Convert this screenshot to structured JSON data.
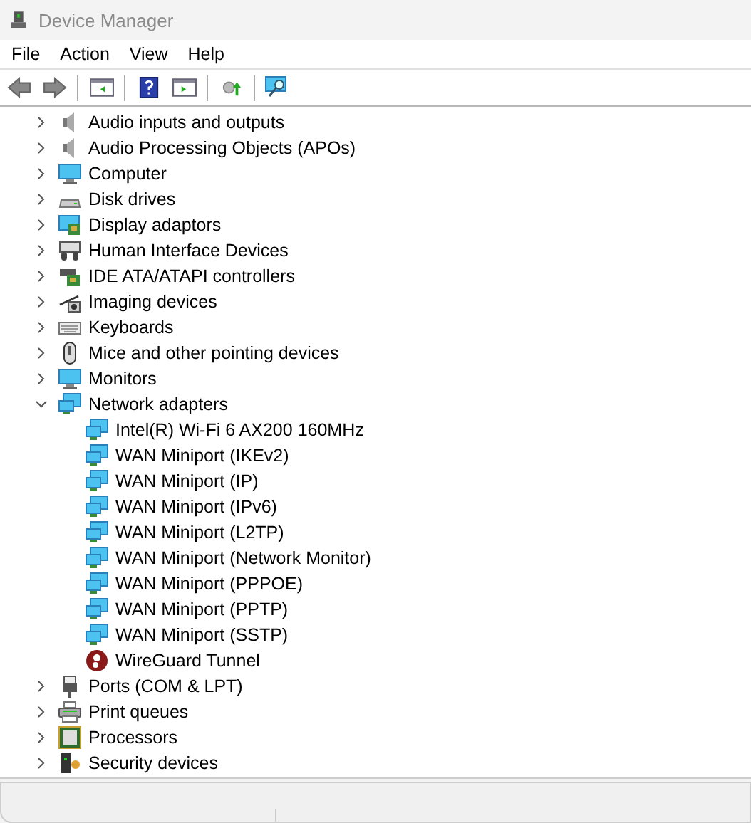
{
  "window": {
    "title": "Device Manager"
  },
  "menu": [
    "File",
    "Action",
    "View",
    "Help"
  ],
  "tree": [
    {
      "label": "Audio inputs and outputs",
      "expanded": false
    },
    {
      "label": "Audio Processing Objects (APOs)",
      "expanded": false
    },
    {
      "label": "Computer",
      "expanded": false
    },
    {
      "label": "Disk drives",
      "expanded": false
    },
    {
      "label": "Display adaptors",
      "expanded": false
    },
    {
      "label": "Human Interface Devices",
      "expanded": false
    },
    {
      "label": "IDE ATA/ATAPI controllers",
      "expanded": false
    },
    {
      "label": "Imaging devices",
      "expanded": false
    },
    {
      "label": "Keyboards",
      "expanded": false
    },
    {
      "label": "Mice and other pointing devices",
      "expanded": false
    },
    {
      "label": "Monitors",
      "expanded": false
    },
    {
      "label": "Network adapters",
      "expanded": true,
      "children": [
        {
          "label": "Intel(R) Wi-Fi 6 AX200 160MHz"
        },
        {
          "label": "WAN Miniport (IKEv2)"
        },
        {
          "label": "WAN Miniport (IP)"
        },
        {
          "label": "WAN Miniport (IPv6)"
        },
        {
          "label": "WAN Miniport (L2TP)"
        },
        {
          "label": "WAN Miniport (Network Monitor)"
        },
        {
          "label": "WAN Miniport (PPPOE)"
        },
        {
          "label": "WAN Miniport (PPTP)"
        },
        {
          "label": "WAN Miniport (SSTP)"
        },
        {
          "label": "WireGuard Tunnel"
        }
      ]
    },
    {
      "label": "Ports (COM & LPT)",
      "expanded": false
    },
    {
      "label": "Print queues",
      "expanded": false
    },
    {
      "label": "Processors",
      "expanded": false
    },
    {
      "label": "Security devices",
      "expanded": false
    }
  ]
}
